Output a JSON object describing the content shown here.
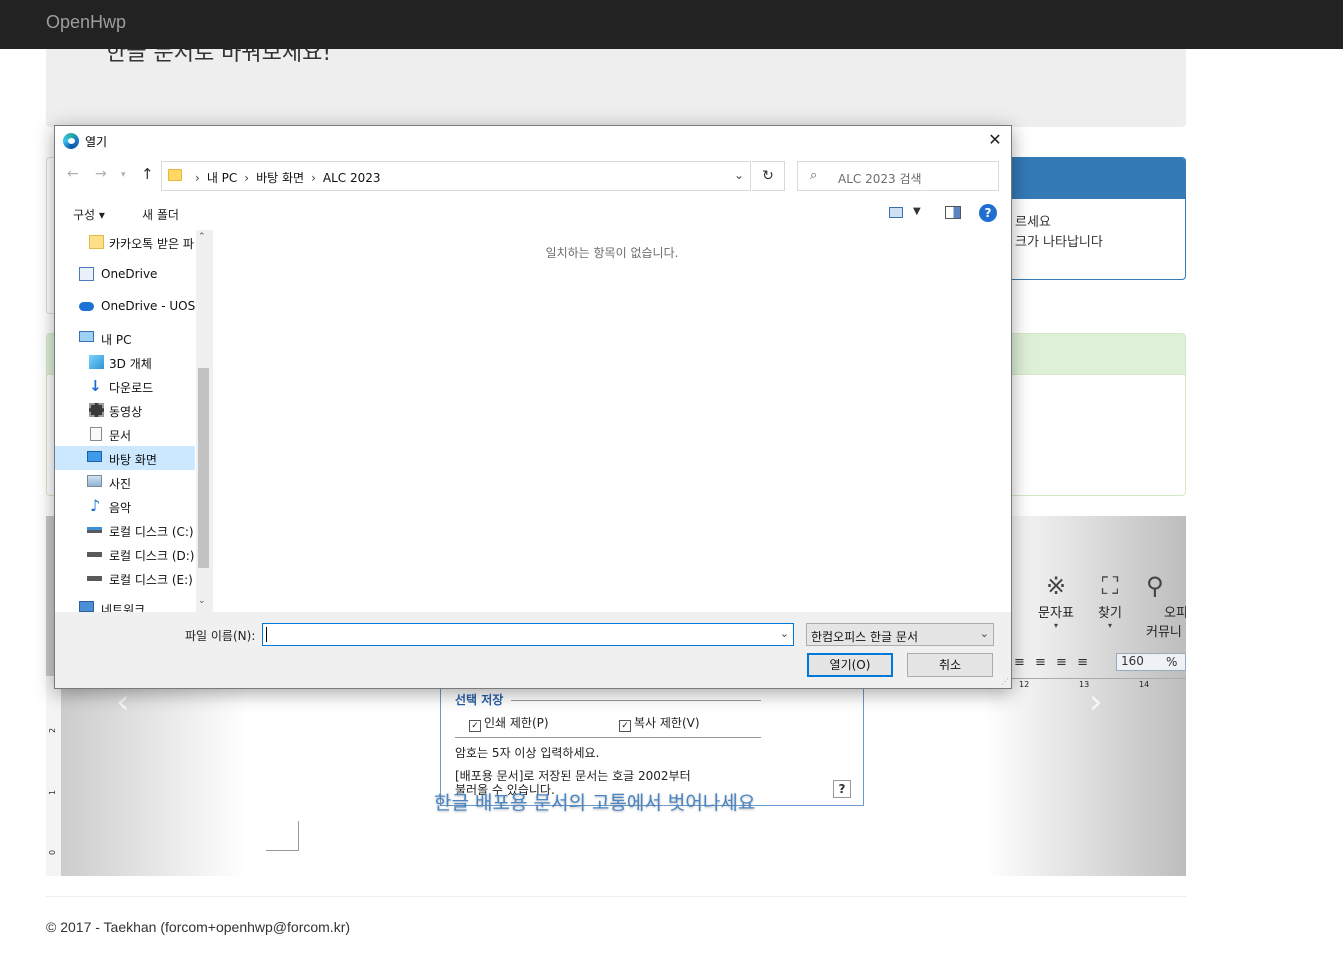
{
  "navbar": {
    "brand": "OpenHwp"
  },
  "jumbotron": {
    "lead": "한글 문서로 바꿔보세요!"
  },
  "panel_blue": {
    "line1": "르세요",
    "line2": "크가 나타납니다"
  },
  "carousel": {
    "tools": [
      {
        "label": "문자표",
        "icon": "※"
      },
      {
        "label": "찾기",
        "icon": "⚲"
      },
      {
        "label": "오피\n커뮤니티",
        "label_top": "오피",
        "label_bottom": "커뮤니",
        "icon": "⚲"
      }
    ],
    "align_buttons": "≡ ≡ ≡ ≡",
    "zoom_value": "160",
    "zoom_unit": "%",
    "ruler_marks": [
      "12",
      "13",
      "14"
    ],
    "vruler_marks": [
      "2",
      "1",
      "0"
    ],
    "caption": "한글 배포용 문서의 고통에서 벗어나세요",
    "inner_dialog": {
      "legend": "선택 저장",
      "print_restrict": "인쇄 제한(P)",
      "copy_restrict": "복사 제한(V)",
      "pw_hint": "암호는 5자 이상 입력하세요.",
      "dist_note_1": "[배포용 문서]로 저장된 문서는 호글 2002부터",
      "dist_note_2": "불러올 수 있습니다.",
      "help": "?"
    }
  },
  "footer": {
    "text": "© 2017 - Taekhan (forcom+openhwp@forcom.kr)"
  },
  "dialog": {
    "title": "열기",
    "close_glyph": "✕",
    "breadcrumb": [
      "내 PC",
      "바탕 화면",
      "ALC 2023"
    ],
    "search_placeholder": "ALC 2023 검색",
    "toolbar": {
      "organize": "구성 ▾",
      "new_folder": "새 폴더"
    },
    "nav_items": [
      {
        "label": "카카오톡 받은 파",
        "icon": "folder-icon",
        "indent": 1
      },
      {
        "label": "OneDrive",
        "icon": "onedrive-icon",
        "indent": 0
      },
      {
        "label": "OneDrive - UOS",
        "icon": "onedrive-cloud-icon",
        "indent": 0
      },
      {
        "label": "내 PC",
        "icon": "pc-icon",
        "indent": 0
      },
      {
        "label": "3D 개체",
        "icon": "cube-icon",
        "indent": 1
      },
      {
        "label": "다운로드",
        "icon": "download-icon",
        "indent": 1
      },
      {
        "label": "동영상",
        "icon": "video-icon",
        "indent": 1
      },
      {
        "label": "문서",
        "icon": "document-icon",
        "indent": 1
      },
      {
        "label": "바탕 화면",
        "icon": "desktop-icon",
        "indent": 1,
        "selected": true
      },
      {
        "label": "사진",
        "icon": "picture-icon",
        "indent": 1
      },
      {
        "label": "음악",
        "icon": "music-icon",
        "indent": 1
      },
      {
        "label": "로컬 디스크 (C:)",
        "icon": "disk-c-icon",
        "indent": 1
      },
      {
        "label": "로컬 디스크 (D:)",
        "icon": "disk-icon",
        "indent": 1
      },
      {
        "label": "로컬 디스크 (E:)",
        "icon": "disk-icon",
        "indent": 1
      },
      {
        "label": "네트워크",
        "icon": "network-icon",
        "indent": 0
      }
    ],
    "empty_message": "일치하는 항목이 없습니다.",
    "filename_label": "파일 이름(N):",
    "filename_value": "",
    "filetype_value": "한컴오피스 한글 문서",
    "open_button": "열기(O)",
    "cancel_button": "취소"
  }
}
